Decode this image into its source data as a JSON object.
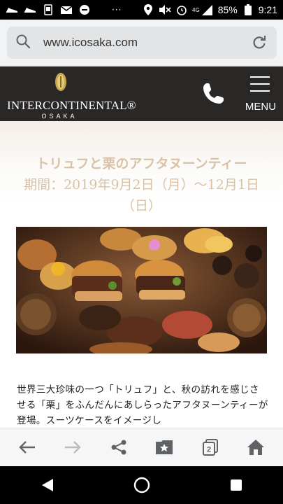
{
  "status_bar": {
    "battery": "85%",
    "time": "9:21",
    "network": "4G",
    "overflow": "···",
    "icons": [
      "shoe-icon",
      "shoe-icon",
      "notification-icon",
      "mail-icon",
      "minus-circle-icon",
      "location-icon",
      "mute-icon",
      "alarm-icon",
      "signal-icon",
      "battery-icon"
    ]
  },
  "browser": {
    "url": "www.icosaka.com",
    "icons": {
      "search": "search-icon",
      "reload": "reload-icon"
    }
  },
  "header": {
    "brand": "INTERCONTINENTAL®",
    "city": "OSAKA",
    "menu_label": "MENU",
    "bg_color": "#2a2727"
  },
  "event": {
    "title": "トリュフと栗のアフタヌーンティー",
    "period": "期間：2019年9月2日（月）〜12月1日（日）",
    "title_color": "#d9c2a6"
  },
  "body": {
    "text": "世界三大珍味の一つ「トリュフ」と、秋の訪れを感じさせる「栗」をふんだんにあしらったアフタヌーンティーが登場。スーツケースをイメージし"
  },
  "toolbar": {
    "items": [
      "back-icon",
      "forward-icon",
      "share-icon",
      "bookmark-icon",
      "tabs-icon",
      "home-icon"
    ],
    "tab_count": "2"
  },
  "nav": {
    "items": [
      "back-triangle-icon",
      "home-circle-icon",
      "recents-square-icon"
    ]
  }
}
